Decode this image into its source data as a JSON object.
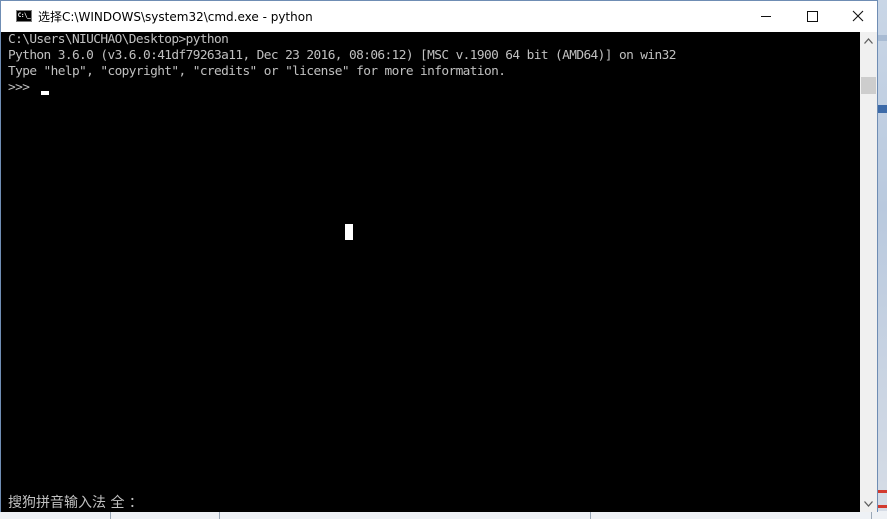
{
  "window": {
    "title": "选择C:\\WINDOWS\\system32\\cmd.exe - python",
    "icon": "cmd-icon",
    "icon_text": "C:\\_",
    "controls": {
      "minimize": "minimize-icon",
      "maximize": "maximize-icon",
      "close": "close-icon"
    }
  },
  "console": {
    "lines": [
      "C:\\Users\\NIUCHAO\\Desktop>python",
      "Python 3.6.0 (v3.6.0:41df79263a11, Dec 23 2016, 08:06:12) [MSC v.1900 64 bit (AMD64)] on win32",
      "Type \"help\", \"copyright\", \"credits\" or \"license\" for more information.",
      ">>> "
    ],
    "ime_status": "搜狗拼音输入法 全 ：",
    "colors": {
      "background": "#000000",
      "foreground": "#c0c0c0",
      "cursor": "#ffffff"
    }
  },
  "scrollbar": {
    "up": "chevron-up-icon",
    "down": "chevron-down-icon"
  }
}
